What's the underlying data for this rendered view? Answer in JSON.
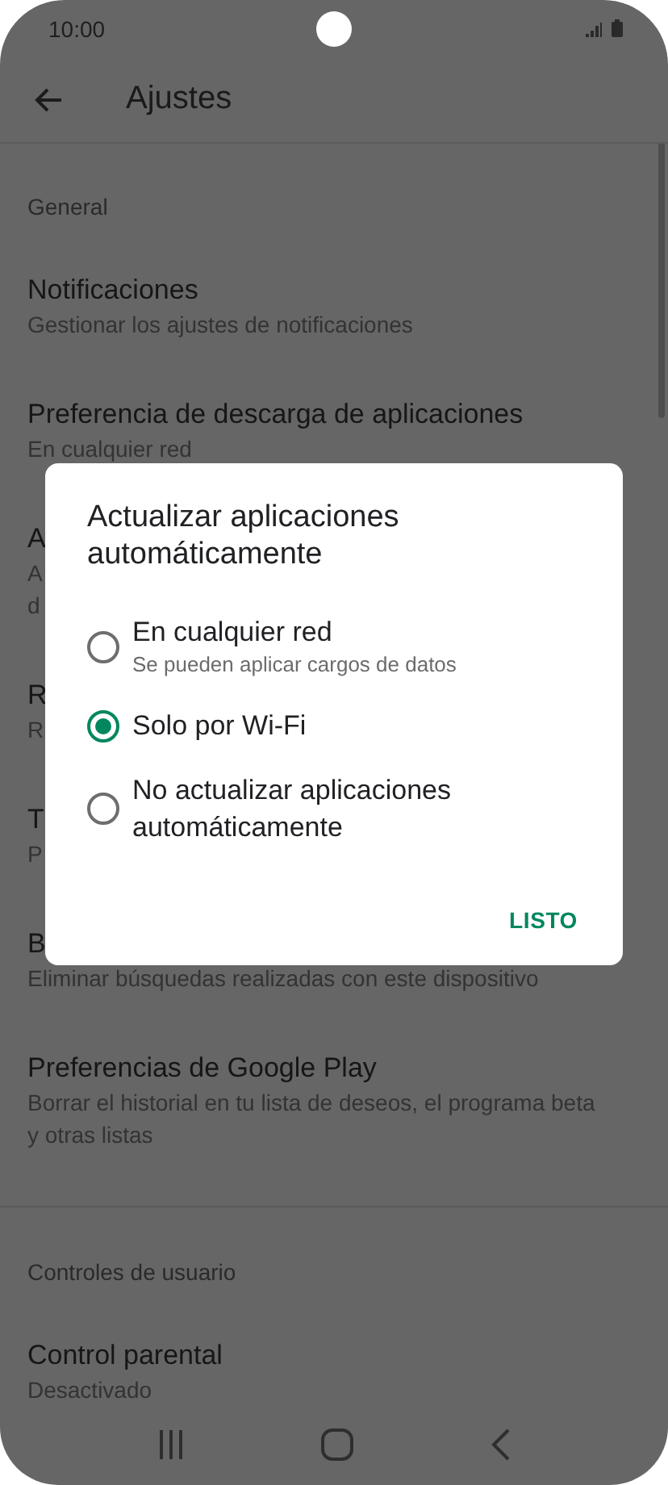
{
  "status_bar": {
    "time": "10:00"
  },
  "toolbar": {
    "title": "Ajustes"
  },
  "sections": [
    {
      "header": "General",
      "items": [
        {
          "title": "Notificaciones",
          "lines": [
            "Gestionar los ajustes de notificaciones"
          ]
        },
        {
          "title": "Preferencia de descarga de aplicaciones",
          "lines": [
            "En cualquier red"
          ]
        },
        {
          "title": "A",
          "lines": [
            "A",
            "d"
          ]
        },
        {
          "title": "R",
          "lines": [
            "R"
          ]
        },
        {
          "title": "T",
          "lines": [
            "P"
          ]
        },
        {
          "title": "B",
          "lines": [
            "Eliminar búsquedas realizadas con este dispositivo"
          ]
        },
        {
          "title": "Preferencias de Google Play",
          "lines": [
            "Borrar el historial en tu lista de deseos, el programa beta",
            "y otras listas"
          ]
        }
      ]
    },
    {
      "header": "Controles de usuario",
      "items": [
        {
          "title": "Control parental",
          "lines": [
            "Desactivado"
          ]
        }
      ]
    }
  ],
  "dialog": {
    "title": "Actualizar aplicaciones automáticamente",
    "options": [
      {
        "label": "En cualquier red",
        "description": "Se pueden aplicar cargos de datos",
        "selected": false
      },
      {
        "label": "Solo por Wi-Fi",
        "selected": true
      },
      {
        "label": "No actualizar aplicaciones automáticamente",
        "selected": false
      }
    ],
    "button": "LISTO"
  }
}
